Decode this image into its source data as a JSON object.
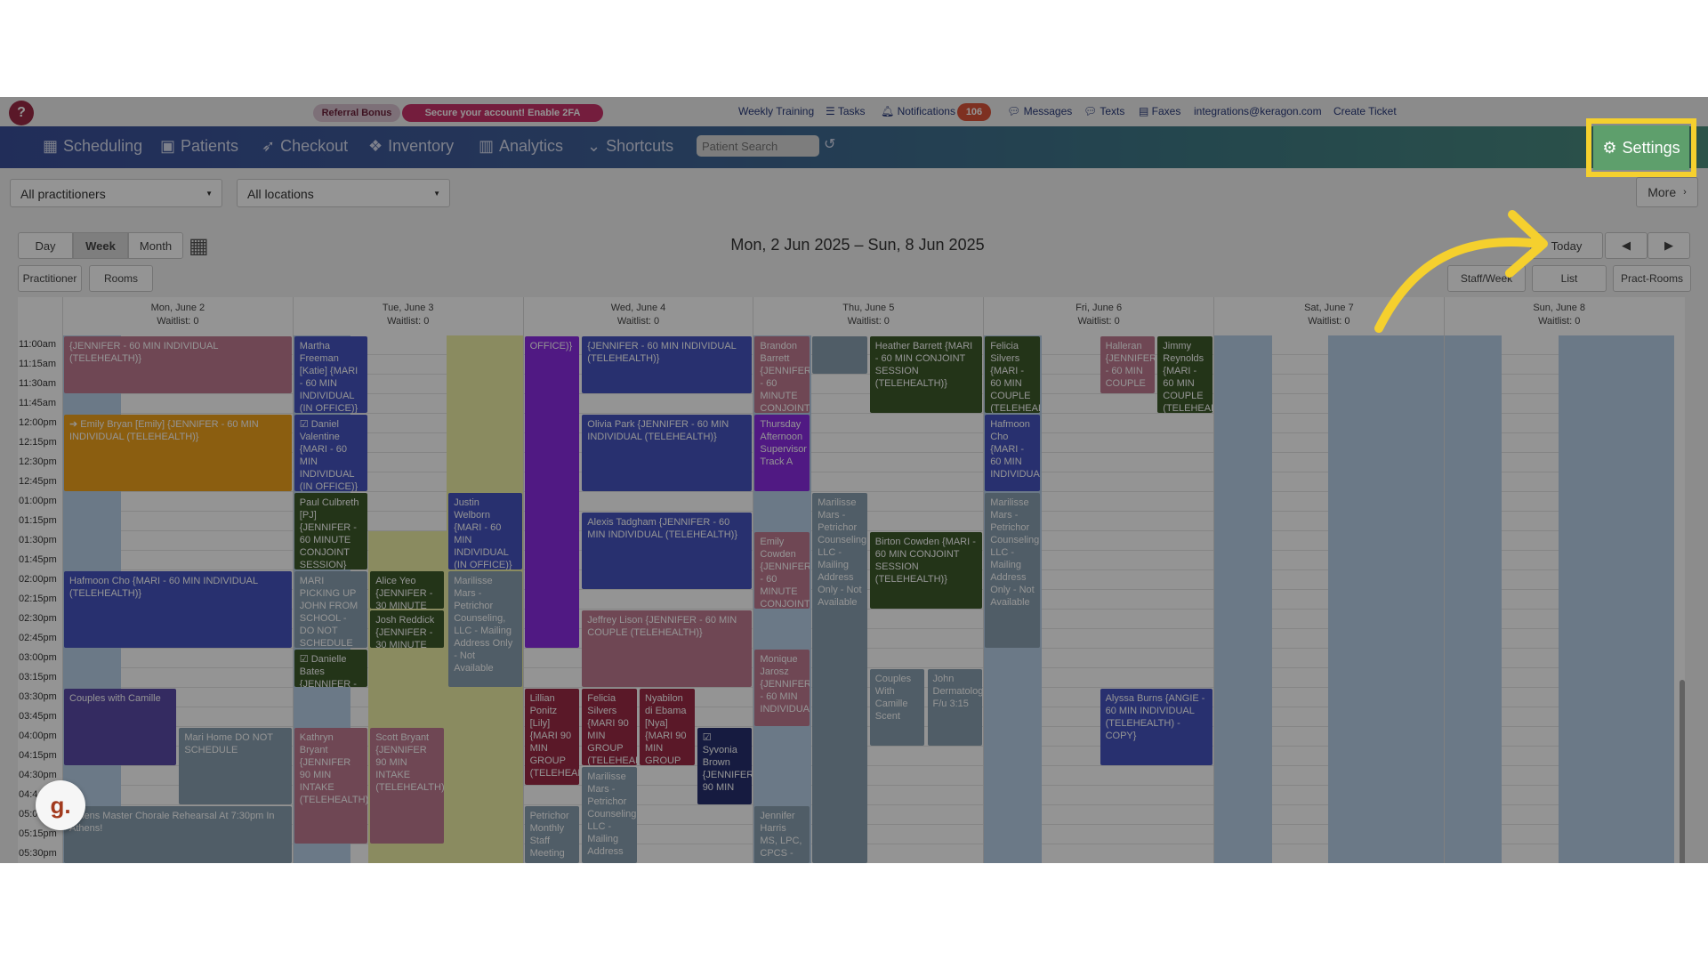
{
  "topbar": {
    "help": "?",
    "referral": "Referral Bonus",
    "secure": "Secure your account! Enable 2FA",
    "links": [
      "Weekly Training",
      "Tasks",
      "Notifications",
      "Messages",
      "Texts",
      "Faxes",
      "integrations@keragon.com",
      "Create Ticket"
    ],
    "notif_count": "106"
  },
  "nav": {
    "items": [
      "Scheduling",
      "Patients",
      "Checkout",
      "Inventory",
      "Analytics",
      "Shortcuts"
    ],
    "search_placeholder": "Patient Search",
    "settings": "Settings"
  },
  "filters": {
    "practitioners": "All practitioners",
    "locations": "All locations",
    "more": "More"
  },
  "view": {
    "day": "Day",
    "week": "Week",
    "month": "Month",
    "today": "Today",
    "range": "Mon, 2 Jun 2025 – Sun, 8 Jun 2025",
    "practitioner": "Practitioner",
    "rooms": "Rooms",
    "staff_week": "Staff/Week",
    "list": "List",
    "pract_rooms": "Pract-Rooms"
  },
  "days": [
    {
      "name": "Mon, June 2",
      "wait": "Waitlist: 0"
    },
    {
      "name": "Tue, June 3",
      "wait": "Waitlist: 0"
    },
    {
      "name": "Wed, June 4",
      "wait": "Waitlist: 0"
    },
    {
      "name": "Thu, June 5",
      "wait": "Waitlist: 0"
    },
    {
      "name": "Fri, June 6",
      "wait": "Waitlist: 0"
    },
    {
      "name": "Sat, June 7",
      "wait": "Waitlist: 0"
    },
    {
      "name": "Sun, June 8",
      "wait": "Waitlist: 0"
    }
  ],
  "times": [
    "11:00am",
    "11:15am",
    "11:30am",
    "11:45am",
    "12:00pm",
    "12:15pm",
    "12:30pm",
    "12:45pm",
    "01:00pm",
    "01:15pm",
    "01:30pm",
    "01:45pm",
    "02:00pm",
    "02:15pm",
    "02:30pm",
    "02:45pm",
    "03:00pm",
    "03:15pm",
    "03:30pm",
    "03:45pm",
    "04:00pm",
    "04:15pm",
    "04:30pm",
    "04:4",
    "05:0",
    "05:15pm",
    "05:30pm"
  ],
  "events": [
    {
      "d": 0,
      "c": 0,
      "w": 1,
      "s": 0,
      "e": 3,
      "t": "{JENNIFER - 60 MIN INDIVIDUAL (TELEHEALTH)}",
      "bg": "#c07a92"
    },
    {
      "d": 0,
      "c": 0,
      "w": 1,
      "s": 4,
      "e": 8,
      "t": "➔ Emily Bryan [Emily] {JENNIFER - 60 MIN INDIVIDUAL (TELEHEALTH)}",
      "bg": "#f0a21c"
    },
    {
      "d": 0,
      "c": 0,
      "w": 1,
      "s": 12,
      "e": 16,
      "t": "Hafmoon Cho {MARI - 60 MIN INDIVIDUAL (TELEHEALTH)}",
      "bg": "#4553c0"
    },
    {
      "d": 0,
      "c": 0,
      "w": 0.5,
      "s": 18,
      "e": 22,
      "t": "Couples with Camille",
      "bg": "#5b4aa8"
    },
    {
      "d": 0,
      "c": 0.5,
      "w": 0.5,
      "s": 20,
      "e": 24,
      "t": "Mari Home DO NOT SCHEDULE",
      "bg": "#8aa1b1"
    },
    {
      "d": 0,
      "c": 0,
      "w": 1,
      "s": 24,
      "e": 27,
      "t": "Athens Master Chorale Rehearsal At 7:30pm In Athens!",
      "bg": "#8aa1b1"
    },
    {
      "d": 1,
      "c": 0,
      "w": 0.33,
      "s": 0,
      "e": 4,
      "t": "Martha Freeman [Katie] {MARI - 60 MIN INDIVIDUAL (IN OFFICE)}",
      "bg": "#4553c0"
    },
    {
      "d": 1,
      "c": 0,
      "w": 0.33,
      "s": 4,
      "e": 8,
      "t": "☑ Daniel Valentine {MARI - 60 MIN INDIVIDUAL (IN OFFICE)}",
      "bg": "#4553c0"
    },
    {
      "d": 1,
      "c": 0,
      "w": 0.33,
      "s": 8,
      "e": 12,
      "t": "Paul Culbreth [PJ] {JENNIFER - 60 MINUTE CONJOINT SESSION}",
      "bg": "#3d5a2a"
    },
    {
      "d": 1,
      "c": 0,
      "w": 0.33,
      "s": 12,
      "e": 16,
      "t": "MARI PICKING UP JOHN FROM SCHOOL - DO NOT SCHEDULE",
      "bg": "#8aa1b1"
    },
    {
      "d": 1,
      "c": 0.33,
      "w": 0.33,
      "s": 12,
      "e": 14,
      "t": "Alice Yeo {JENNIFER - 30 MINUTE",
      "bg": "#3d5a2a"
    },
    {
      "d": 1,
      "c": 0.33,
      "w": 0.33,
      "s": 14,
      "e": 16,
      "t": "Josh Reddick {JENNIFER - 30 MINUTE",
      "bg": "#3d5a2a"
    },
    {
      "d": 1,
      "c": 0,
      "w": 0.33,
      "s": 16,
      "e": 18,
      "t": "☑ Danielle Bates {JENNIFER -",
      "bg": "#3d5a2a"
    },
    {
      "d": 1,
      "c": 0,
      "w": 0.33,
      "s": 20,
      "e": 26,
      "t": "Kathryn Bryant {JENNIFER 90 MIN INTAKE (TELEHEALTH)}",
      "bg": "#c07a92"
    },
    {
      "d": 1,
      "c": 0.33,
      "w": 0.33,
      "s": 20,
      "e": 26,
      "t": "Scott Bryant {JENNIFER 90 MIN INTAKE (TELEHEALTH)}",
      "bg": "#c07a92"
    },
    {
      "d": 1,
      "c": 0.67,
      "w": 0.33,
      "s": 8,
      "e": 12,
      "t": "Justin Welborn {MARI - 60 MIN INDIVIDUAL (IN OFFICE)}",
      "bg": "#4553c0"
    },
    {
      "d": 1,
      "c": 0.67,
      "w": 0.33,
      "s": 12,
      "e": 18,
      "t": "Marilisse Mars - Petrichor Counseling, LLC - Mailing Address Only - Not Available",
      "bg": "#8aa1b1"
    },
    {
      "d": 2,
      "c": 0,
      "w": 0.25,
      "s": 0,
      "e": 16,
      "t": "OFFICE)}",
      "bg": "#8a2be2"
    },
    {
      "d": 2,
      "c": 0.25,
      "w": 0.75,
      "s": 0,
      "e": 3,
      "t": "{JENNIFER - 60 MIN INDIVIDUAL (TELEHEALTH)}",
      "bg": "#4553c0"
    },
    {
      "d": 2,
      "c": 0.25,
      "w": 0.75,
      "s": 4,
      "e": 8,
      "t": "Olivia Park {JENNIFER - 60 MIN INDIVIDUAL (TELEHEALTH)}",
      "bg": "#4553c0"
    },
    {
      "d": 2,
      "c": 0.25,
      "w": 0.75,
      "s": 9,
      "e": 13,
      "t": "Alexis Tadgham {JENNIFER - 60 MIN INDIVIDUAL (TELEHEALTH)}",
      "bg": "#4553c0"
    },
    {
      "d": 2,
      "c": 0.25,
      "w": 0.75,
      "s": 14,
      "e": 18,
      "t": "Jeffrey Lison {JENNIFER - 60 MIN COUPLE (TELEHEALTH)}",
      "bg": "#c07a92"
    },
    {
      "d": 2,
      "c": 0,
      "w": 0.25,
      "s": 18,
      "e": 23,
      "t": "Lillian Ponitz [Lily] {MARI 90 MIN GROUP (TELEHEALTH)}",
      "bg": "#9b2a45"
    },
    {
      "d": 2,
      "c": 0.25,
      "w": 0.25,
      "s": 18,
      "e": 22,
      "t": "Felicia Silvers {MARI 90 MIN GROUP (TELEHEALTH)}",
      "bg": "#9b2a45"
    },
    {
      "d": 2,
      "c": 0.5,
      "w": 0.25,
      "s": 18,
      "e": 22,
      "t": "Nyabilon di Ebama [Nya] {MARI 90 MIN GROUP",
      "bg": "#9b2a45"
    },
    {
      "d": 2,
      "c": 0.75,
      "w": 0.25,
      "s": 20,
      "e": 24,
      "t": "☑ Syvonia Brown {JENNIFER 90 MIN",
      "bg": "#26306e"
    },
    {
      "d": 2,
      "c": 0.25,
      "w": 0.25,
      "s": 22,
      "e": 27,
      "t": "Marilisse Mars - Petrichor Counseling, LLC - Mailing Address",
      "bg": "#8aa1b1"
    },
    {
      "d": 2,
      "c": 0,
      "w": 0.25,
      "s": 24,
      "e": 27,
      "t": "Petrichor Monthly Staff Meeting",
      "bg": "#8aa1b1"
    },
    {
      "d": 3,
      "c": 0,
      "w": 0.25,
      "s": 0,
      "e": 4,
      "t": "Brandon Barrett {JENNIFER - 60 MINUTE CONJOINT",
      "bg": "#c07a92"
    },
    {
      "d": 3,
      "c": 0,
      "w": 0.25,
      "s": 4,
      "e": 8,
      "t": "Thursday Afternoon Supervisor Track A",
      "bg": "#8a2be2"
    },
    {
      "d": 3,
      "c": 0,
      "w": 0.25,
      "s": 10,
      "e": 14,
      "t": "Emily Cowden {JENNIFER - 60 MINUTE CONJOINT",
      "bg": "#c07a92"
    },
    {
      "d": 3,
      "c": 0,
      "w": 0.25,
      "s": 16,
      "e": 20,
      "t": "Monique Jarosz {JENNIFER - 60 MIN INDIVIDUAL",
      "bg": "#c07a92"
    },
    {
      "d": 3,
      "c": 0,
      "w": 0.25,
      "s": 24,
      "e": 27,
      "t": "Jennifer Harris MS, LPC, CPCS -",
      "bg": "#8aa1b1"
    },
    {
      "d": 3,
      "c": 0.25,
      "w": 0.25,
      "s": 0,
      "e": 2,
      "t": "",
      "bg": "#8aa1b1"
    },
    {
      "d": 3,
      "c": 0.25,
      "w": 0.25,
      "s": 8,
      "e": 27,
      "t": "Marilisse Mars - Petrichor Counseling, LLC - Mailing Address Only - Not Available",
      "bg": "#8aa1b1"
    },
    {
      "d": 3,
      "c": 0.5,
      "w": 0.5,
      "s": 0,
      "e": 4,
      "t": "Heather Barrett {MARI - 60 MIN CONJOINT SESSION (TELEHEALTH)}",
      "bg": "#3d5a2a"
    },
    {
      "d": 3,
      "c": 0.5,
      "w": 0.5,
      "s": 10,
      "e": 14,
      "t": "Birton Cowden {MARI - 60 MIN CONJOINT SESSION (TELEHEALTH)}",
      "bg": "#3d5a2a"
    },
    {
      "d": 3,
      "c": 0.5,
      "w": 0.25,
      "s": 17,
      "e": 21,
      "t": "Couples With Camille Scent",
      "bg": "#8aa1b1"
    },
    {
      "d": 3,
      "c": 0.75,
      "w": 0.25,
      "s": 17,
      "e": 21,
      "t": "John Dermatology F/u 3:15",
      "bg": "#8aa1b1"
    },
    {
      "d": 4,
      "c": 0,
      "w": 0.25,
      "s": 0,
      "e": 4,
      "t": "Felicia Silvers {MARI - 60 MIN COUPLE (TELEHEALTH)",
      "bg": "#3d5a2a"
    },
    {
      "d": 4,
      "c": 0,
      "w": 0.25,
      "s": 4,
      "e": 8,
      "t": "Hafmoon Cho {MARI - 60 MIN INDIVIDUAL",
      "bg": "#4553c0"
    },
    {
      "d": 4,
      "c": 0,
      "w": 0.25,
      "s": 8,
      "e": 16,
      "t": "Marilisse Mars - Petrichor Counseling, LLC - Mailing Address Only - Not Available",
      "bg": "#8aa1b1"
    },
    {
      "d": 4,
      "c": 0.5,
      "w": 0.25,
      "s": 0,
      "e": 3,
      "t": "Halleran {JENNIFER - 60 MIN COUPLE",
      "bg": "#c07a92"
    },
    {
      "d": 4,
      "c": 0.75,
      "w": 0.25,
      "s": 0,
      "e": 4,
      "t": "Jimmy Reynolds {MARI - 60 MIN COUPLE (TELEHEALTH",
      "bg": "#3d5a2a"
    },
    {
      "d": 4,
      "c": 0.5,
      "w": 0.5,
      "s": 18,
      "e": 22,
      "t": "Alyssa Burns {ANGIE - 60 MIN INDIVIDUAL (TELEHEALTH) - COPY}",
      "bg": "#4553c0"
    }
  ],
  "badge": "g."
}
